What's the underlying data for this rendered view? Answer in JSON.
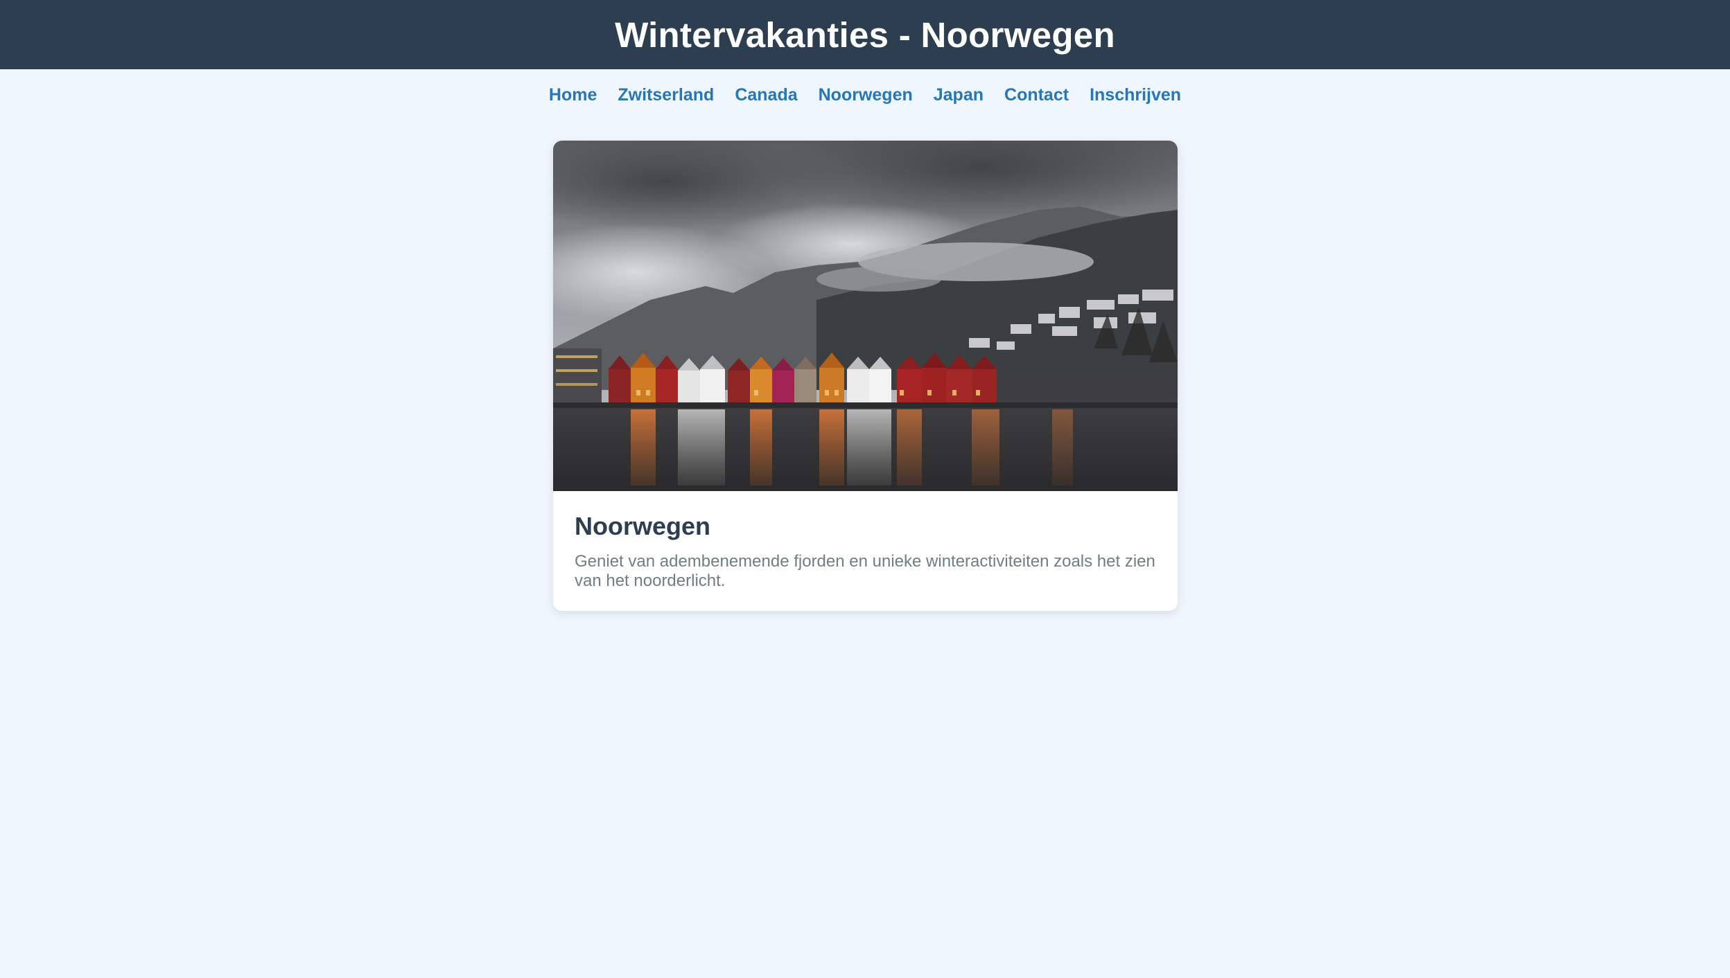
{
  "header": {
    "title": "Wintervakanties - Noorwegen"
  },
  "nav": {
    "items": [
      {
        "label": "Home"
      },
      {
        "label": "Zwitserland"
      },
      {
        "label": "Canada"
      },
      {
        "label": "Noorwegen"
      },
      {
        "label": "Japan"
      },
      {
        "label": "Contact"
      },
      {
        "label": "Inschrijven"
      }
    ]
  },
  "card": {
    "title": "Noorwegen",
    "description": "Geniet van adembenemende fjorden en unieke winteractiviteiten zoals het zien van het noorderlicht."
  },
  "colors": {
    "header_bg": "#2d3e50",
    "page_bg": "#eff6fe",
    "nav_link": "#2776b5",
    "card_title": "#2d3e50",
    "card_text": "#6f7d86"
  }
}
